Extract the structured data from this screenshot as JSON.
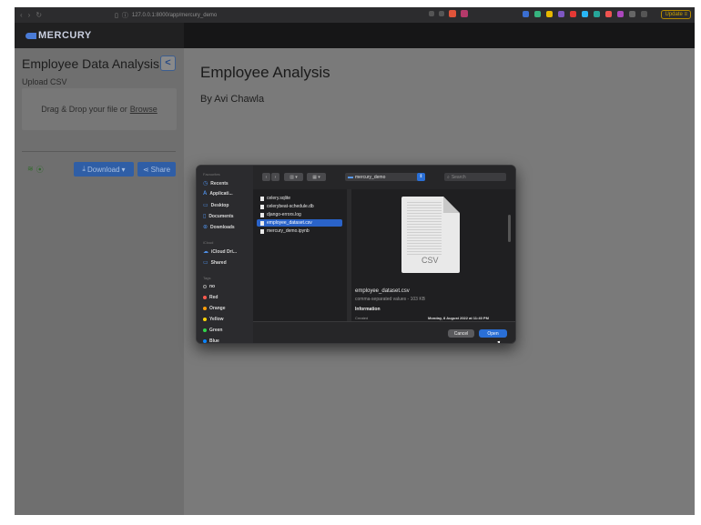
{
  "browser": {
    "url": "127.0.0.1:8000/app/mercury_demo",
    "update_label": "Update"
  },
  "navbar": {
    "brand": "MERCURY"
  },
  "sidebar": {
    "title": "Employee Data Analysis",
    "collapse_glyph": "<",
    "upload_label": "Upload CSV",
    "dropzone_text": "Drag & Drop your file or",
    "browse_link": "Browse",
    "status_glyphs": [
      "≋",
      "⦿"
    ],
    "download_label": "Download",
    "share_label": "Share"
  },
  "main": {
    "title": "Employee Analysis",
    "byline": "By Avi Chawla"
  },
  "dialog": {
    "sections": {
      "favourites": "Favourites",
      "icloud": "iCloud",
      "tags": "Tags"
    },
    "favourites": [
      "Recents",
      "Applicati...",
      "Desktop",
      "Documents",
      "Downloads"
    ],
    "icloud": [
      "iCloud Dri...",
      "Shared"
    ],
    "tags": [
      {
        "label": "no",
        "color": "#9a9a9a"
      },
      {
        "label": "Red",
        "color": "#ff5a4f"
      },
      {
        "label": "Orange",
        "color": "#ff9f0a"
      },
      {
        "label": "Yellow",
        "color": "#ffd60a"
      },
      {
        "label": "Green",
        "color": "#32d74b"
      },
      {
        "label": "Blue",
        "color": "#0a84ff"
      }
    ],
    "location": "mercury_demo",
    "search_placeholder": "Search",
    "files": [
      "celery.sqlite",
      "celerybeat-schedule.db",
      "django-errors.log",
      "employee_dataset.csv",
      "mercury_demo.ipynb"
    ],
    "selected_file": "employee_dataset.csv",
    "preview": {
      "ext": "CSV",
      "name": "employee_dataset.csv",
      "kind": "comma-separated values - 103 KB",
      "info_heading": "Information",
      "created_label": "Created",
      "created_value": "Monday, 8 August 2022 at 11:40 PM"
    },
    "cancel_label": "Cancel",
    "open_label": "Open"
  }
}
